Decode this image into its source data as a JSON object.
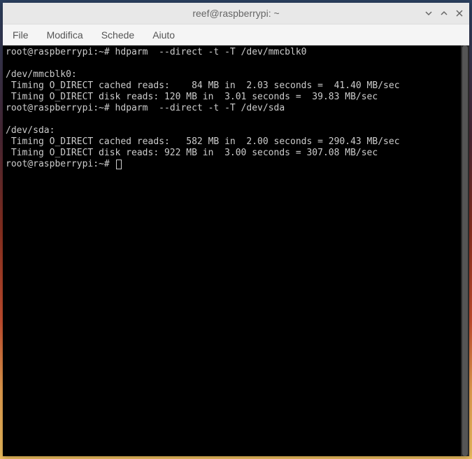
{
  "titlebar": {
    "title": "reef@raspberrypi: ~"
  },
  "menubar": {
    "items": [
      {
        "label": "File"
      },
      {
        "label": "Modifica"
      },
      {
        "label": "Schede"
      },
      {
        "label": "Aiuto"
      }
    ]
  },
  "terminal": {
    "prompt": "root@raspberrypi:~# ",
    "lines": [
      {
        "prompt": true,
        "cmd": "hdparm  --direct -t -T /dev/mmcblk0"
      },
      {
        "text": ""
      },
      {
        "text": "/dev/mmcblk0:"
      },
      {
        "text": " Timing O_DIRECT cached reads:    84 MB in  2.03 seconds =  41.40 MB/sec"
      },
      {
        "text": " Timing O_DIRECT disk reads: 120 MB in  3.01 seconds =  39.83 MB/sec"
      },
      {
        "prompt": true,
        "cmd": "hdparm  --direct -t -T /dev/sda"
      },
      {
        "text": ""
      },
      {
        "text": "/dev/sda:"
      },
      {
        "text": " Timing O_DIRECT cached reads:   582 MB in  2.00 seconds = 290.43 MB/sec"
      },
      {
        "text": " Timing O_DIRECT disk reads: 922 MB in  3.00 seconds = 307.08 MB/sec"
      },
      {
        "prompt": true,
        "cmd": "",
        "cursor": true
      }
    ]
  }
}
